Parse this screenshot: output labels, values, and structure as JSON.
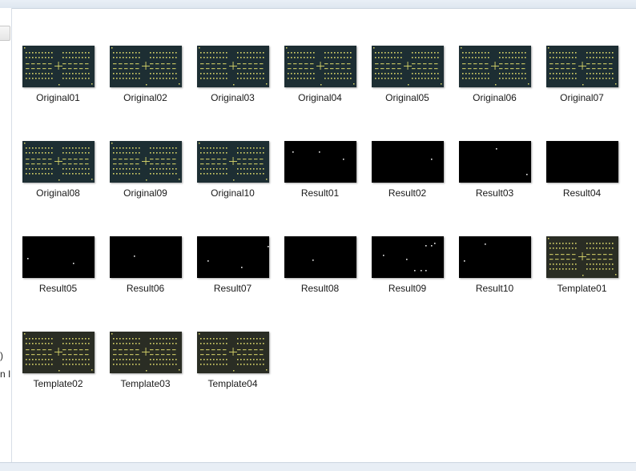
{
  "window": {
    "left_partial_texts": [
      ")",
      "n I"
    ]
  },
  "files": [
    {
      "name": "Original01",
      "kind": "original"
    },
    {
      "name": "Original02",
      "kind": "original"
    },
    {
      "name": "Original03",
      "kind": "original"
    },
    {
      "name": "Original04",
      "kind": "original"
    },
    {
      "name": "Original05",
      "kind": "original"
    },
    {
      "name": "Original06",
      "kind": "original"
    },
    {
      "name": "Original07",
      "kind": "original"
    },
    {
      "name": "Original08",
      "kind": "original"
    },
    {
      "name": "Original09",
      "kind": "original"
    },
    {
      "name": "Original10",
      "kind": "original"
    },
    {
      "name": "Result01",
      "kind": "result"
    },
    {
      "name": "Result02",
      "kind": "result"
    },
    {
      "name": "Result03",
      "kind": "result"
    },
    {
      "name": "Result04",
      "kind": "result"
    },
    {
      "name": "Result05",
      "kind": "result"
    },
    {
      "name": "Result06",
      "kind": "result"
    },
    {
      "name": "Result07",
      "kind": "result"
    },
    {
      "name": "Result08",
      "kind": "result"
    },
    {
      "name": "Result09",
      "kind": "result"
    },
    {
      "name": "Result10",
      "kind": "result"
    },
    {
      "name": "Template01",
      "kind": "template"
    },
    {
      "name": "Template02",
      "kind": "template"
    },
    {
      "name": "Template03",
      "kind": "template"
    },
    {
      "name": "Template04",
      "kind": "template"
    }
  ],
  "colors": {
    "original_bg": "#1d2e33",
    "template_bg": "#2a2d24",
    "pad": "#d9d66a",
    "result_bg": "#000000",
    "result_dot": "#e8e8e8"
  }
}
